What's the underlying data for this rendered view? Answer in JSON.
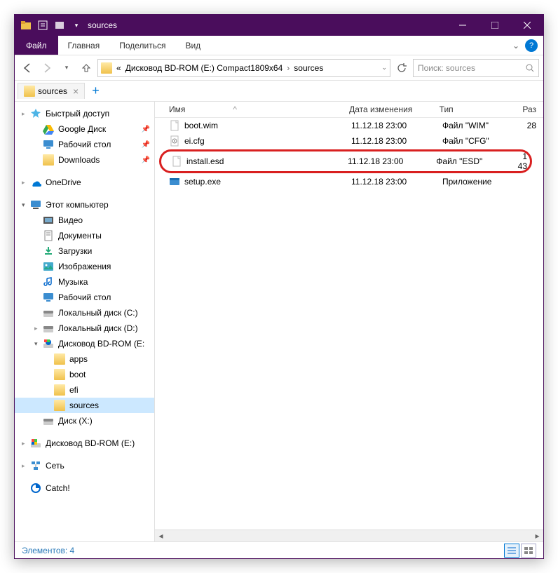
{
  "title": "sources",
  "ribbon": {
    "file": "Файл",
    "tabs": [
      "Главная",
      "Поделиться",
      "Вид"
    ]
  },
  "breadcrumb": {
    "prefix": "«",
    "path1": "Дисковод BD-ROM (E:) Compact1809x64",
    "path2": "sources"
  },
  "search": {
    "placeholder": "Поиск: sources"
  },
  "folder_tab": "sources",
  "columns": {
    "name": "Имя",
    "date": "Дата изменения",
    "type": "Тип",
    "size": "Раз"
  },
  "sidebar": {
    "quick": "Быстрый доступ",
    "gdrive": "Google Диск",
    "desktop": "Рабочий стол",
    "downloads": "Downloads",
    "onedrive": "OneDrive",
    "thispc": "Этот компьютер",
    "video": "Видео",
    "documents": "Документы",
    "downloads2": "Загрузки",
    "pictures": "Изображения",
    "music": "Музыка",
    "desktop2": "Рабочий стол",
    "localC": "Локальный диск (C:)",
    "localD": "Локальный диск (D:)",
    "bdrom": "Дисковод BD-ROM (E:",
    "apps": "apps",
    "boot": "boot",
    "efi": "efi",
    "sources": "sources",
    "diskX": "Диск (X:)",
    "bdrom2": "Дисковод BD-ROM (E:)",
    "network": "Сеть",
    "catch": "Catch!"
  },
  "files": [
    {
      "name": "boot.wim",
      "date": "11.12.18 23:00",
      "type": "Файл \"WIM\"",
      "size": "28",
      "icon": "file",
      "hl": false
    },
    {
      "name": "ei.cfg",
      "date": "11.12.18 23:00",
      "type": "Файл \"CFG\"",
      "size": "",
      "icon": "cfg",
      "hl": false
    },
    {
      "name": "install.esd",
      "date": "11.12.18 23:00",
      "type": "Файл \"ESD\"",
      "size": "1 43",
      "icon": "file",
      "hl": true
    },
    {
      "name": "setup.exe",
      "date": "11.12.18 23:00",
      "type": "Приложение",
      "size": "",
      "icon": "exe",
      "hl": false
    }
  ],
  "status": "Элементов: 4"
}
